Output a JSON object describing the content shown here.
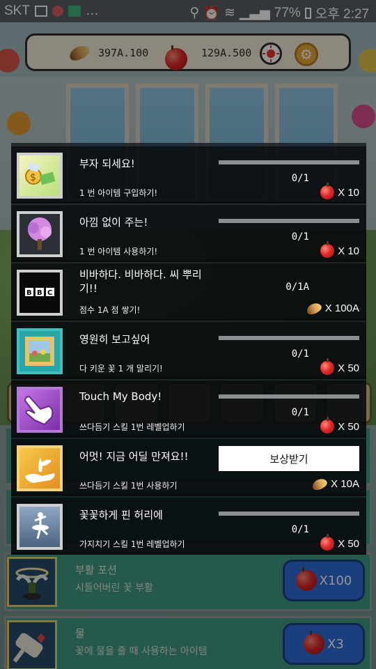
{
  "statusbar": {
    "carrier": "SKT",
    "battery": "77%",
    "time": "오후 2:27"
  },
  "currency": {
    "seeds": "397A.100",
    "apples": "129A.500"
  },
  "achievements": [
    {
      "title": "부자 되세요!",
      "desc": "1 번 아이템 구입하기!",
      "progress": "0/1",
      "reward": "X 10",
      "reward_type": "apple"
    },
    {
      "title": "아낌 없이 주는!",
      "desc": "1 번 아이템 사용하기!",
      "progress": "0/1",
      "reward": "X 10",
      "reward_type": "apple"
    },
    {
      "title": "비바하다. 비바하다. 씨 뿌리기!!",
      "desc": "점수 1A 점 쌓기!",
      "progress": "0/1A",
      "reward": "X 100A",
      "reward_type": "seed"
    },
    {
      "title": "영원히 보고싶어",
      "desc": "다 키운 꽃 1 개 말리기!",
      "progress": "0/1",
      "reward": "X 50",
      "reward_type": "apple"
    },
    {
      "title": "Touch My Body!",
      "desc": "쓰다듬기 스킬 1번 레벨업하기",
      "progress": "0/1",
      "reward": "X 50",
      "reward_type": "apple"
    },
    {
      "title": "어멋! 지금 어딜 만져요!!",
      "desc": "쓰다듬기 스킬 1번 사용하기",
      "claim_label": "보상받기",
      "reward": "X 10A",
      "reward_type": "seed"
    },
    {
      "title": "꽃꽃하게 핀 허리에",
      "desc": "가지치기 스킬 1번 레벨업하기",
      "progress": "0/1",
      "reward": "X 50",
      "reward_type": "apple"
    }
  ],
  "shop": [
    {
      "title": "부활 포션",
      "desc": "시들어버린 꽃 부활",
      "price": "X100"
    },
    {
      "title": "물",
      "desc": "꽃에 물을 줄 때 사용하는 아이템",
      "price": "X3"
    }
  ]
}
